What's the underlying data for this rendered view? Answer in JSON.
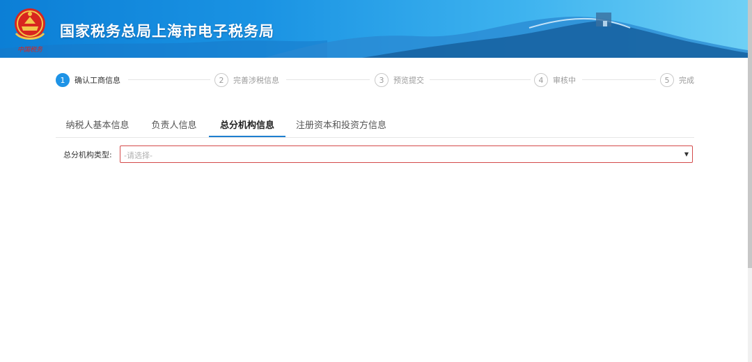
{
  "header": {
    "title": "国家税务总局上海市电子税务局",
    "emblem_caption": "中国税务"
  },
  "steps": [
    {
      "number": "1",
      "label": "确认工商信息",
      "active": true
    },
    {
      "number": "2",
      "label": "完善涉税信息",
      "active": false
    },
    {
      "number": "3",
      "label": "预览提交",
      "active": false
    },
    {
      "number": "4",
      "label": "审核中",
      "active": false
    },
    {
      "number": "5",
      "label": "完成",
      "active": false
    }
  ],
  "tabs": [
    {
      "label": "纳税人基本信息",
      "active": false
    },
    {
      "label": "负责人信息",
      "active": false
    },
    {
      "label": "总分机构信息",
      "active": true
    },
    {
      "label": "注册资本和投资方信息",
      "active": false
    }
  ],
  "form": {
    "branch_type_label": "总分机构类型:",
    "branch_type_placeholder": "-请选择-"
  },
  "colors": {
    "accent": "#1e93e6",
    "error_border": "#d44a4a",
    "header_gradient_start": "#0c7fd6",
    "header_gradient_end": "#6fd0f5"
  }
}
